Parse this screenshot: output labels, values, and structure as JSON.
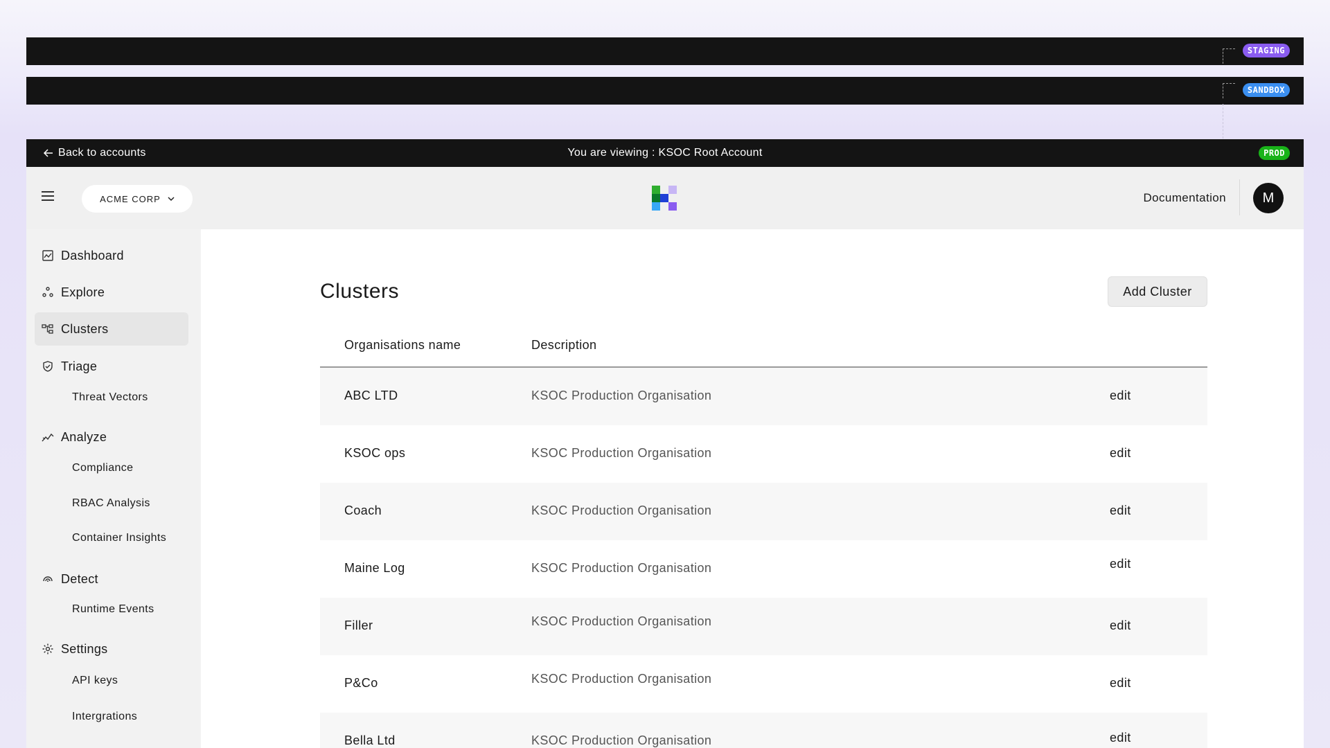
{
  "environments": [
    {
      "badge": "STAGING",
      "color": "#8a5cf0"
    },
    {
      "badge": "SANDBOX",
      "color": "#3b8ff0"
    }
  ],
  "viewing_bar": {
    "back_label": "Back to accounts",
    "viewing_text": "You are viewing : KSOC Root Account",
    "env_badge": "PROD"
  },
  "topbar": {
    "org_selector": "ACME CORP",
    "documentation": "Documentation",
    "avatar_initial": "M"
  },
  "sidebar": {
    "dashboard": "Dashboard",
    "explore": "Explore",
    "clusters": "Clusters",
    "triage": "Triage",
    "threat_vectors": "Threat Vectors",
    "analyze": "Analyze",
    "compliance": "Compliance",
    "rbac_analysis": "RBAC Analysis",
    "container_insights": "Container Insights",
    "detect": "Detect",
    "runtime_events": "Runtime Events",
    "settings": "Settings",
    "api_keys": "API keys",
    "integrations": "Intergrations"
  },
  "main": {
    "title": "Clusters",
    "add_button": "Add Cluster",
    "columns": [
      "Organisations name",
      "Description"
    ],
    "rows": [
      {
        "name": "ABC LTD",
        "description": "KSOC Production Organisation",
        "action": "edit"
      },
      {
        "name": "KSOC ops",
        "description": "KSOC Production Organisation",
        "action": "edit"
      },
      {
        "name": "Coach",
        "description": "KSOC Production Organisation",
        "action": "edit"
      },
      {
        "name": "Maine Log",
        "description": "KSOC Production Organisation",
        "action": "edit"
      },
      {
        "name": "Filler",
        "description": "KSOC Production Organisation",
        "action": "edit"
      },
      {
        "name": "P&Co",
        "description": "KSOC Production Organisation",
        "action": "edit"
      },
      {
        "name": "Bella Ltd",
        "description": "KSOC Production Organisation",
        "action": "edit"
      }
    ]
  }
}
